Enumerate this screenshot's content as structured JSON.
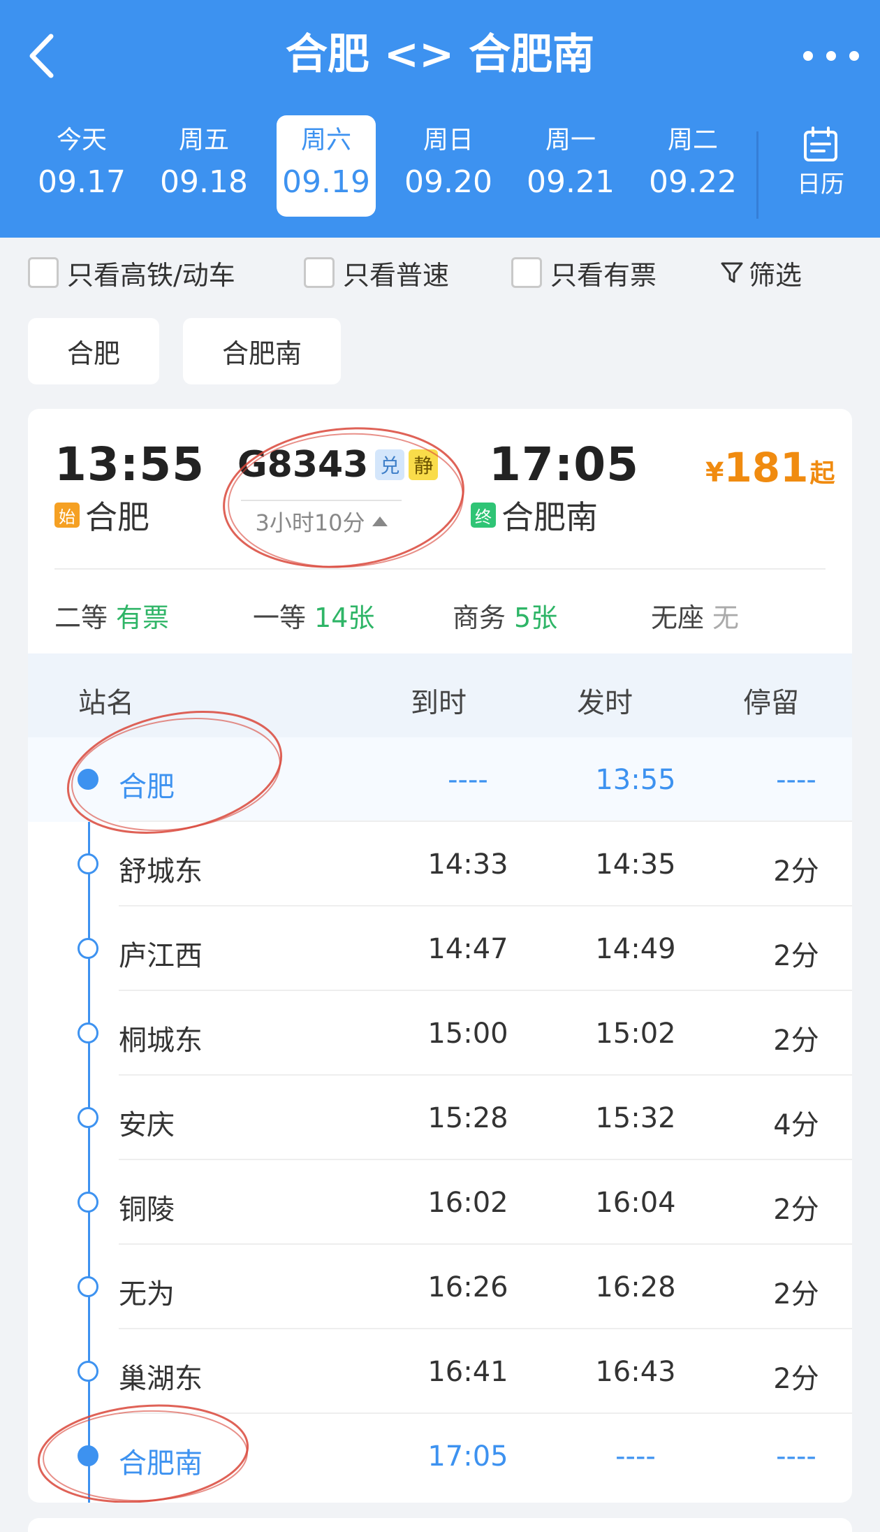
{
  "header": {
    "title": "合肥 <> 合肥南",
    "back_icon": "chevron-left-icon",
    "more_icon": "more-dots-icon"
  },
  "dates": [
    {
      "weekday": "今天",
      "date": "09.17",
      "active": false
    },
    {
      "weekday": "周五",
      "date": "09.18",
      "active": false
    },
    {
      "weekday": "周六",
      "date": "09.19",
      "active": true
    },
    {
      "weekday": "周日",
      "date": "09.20",
      "active": false
    },
    {
      "weekday": "周一",
      "date": "09.21",
      "active": false
    },
    {
      "weekday": "周二",
      "date": "09.22",
      "active": false
    }
  ],
  "calendar": {
    "label": "日历",
    "icon": "calendar-icon"
  },
  "filters": {
    "high_speed": "只看高铁/动车",
    "normal": "只看普速",
    "available": "只看有票",
    "filter": "筛选",
    "filter_icon": "funnel-icon"
  },
  "station_chips": [
    "合肥",
    "合肥南"
  ],
  "train": {
    "dep_time": "13:55",
    "dep_station": "合肥",
    "start_badge": "始",
    "train_no": "G8343",
    "tag_exchange": "兑",
    "tag_quiet": "静",
    "duration": "3小时10分",
    "arr_time": "17:05",
    "arr_station": "合肥南",
    "end_badge": "终",
    "price_currency": "¥",
    "price": "181",
    "price_suffix": "起"
  },
  "seats": [
    {
      "name": "二等",
      "value": "有票"
    },
    {
      "name": "一等",
      "value": "14张"
    },
    {
      "name": "商务",
      "value": "5张"
    },
    {
      "name": "无座",
      "value": "无"
    }
  ],
  "table": {
    "headers": {
      "station": "站名",
      "arrive": "到时",
      "depart": "发时",
      "stop": "停留"
    },
    "rows": [
      {
        "station": "合肥",
        "arrive": "----",
        "depart": "13:55",
        "stop": "----"
      },
      {
        "station": "舒城东",
        "arrive": "14:33",
        "depart": "14:35",
        "stop": "2分"
      },
      {
        "station": "庐江西",
        "arrive": "14:47",
        "depart": "14:49",
        "stop": "2分"
      },
      {
        "station": "桐城东",
        "arrive": "15:00",
        "depart": "15:02",
        "stop": "2分"
      },
      {
        "station": "安庆",
        "arrive": "15:28",
        "depart": "15:32",
        "stop": "4分"
      },
      {
        "station": "铜陵",
        "arrive": "16:02",
        "depart": "16:04",
        "stop": "2分"
      },
      {
        "station": "无为",
        "arrive": "16:26",
        "depart": "16:28",
        "stop": "2分"
      },
      {
        "station": "巢湖东",
        "arrive": "16:41",
        "depart": "16:43",
        "stop": "2分"
      },
      {
        "station": "合肥南",
        "arrive": "17:05",
        "depart": "----",
        "stop": "----"
      }
    ]
  },
  "colors": {
    "primary": "#3d92f0",
    "price": "#f08b10",
    "available": "#2fb567",
    "annotation": "#d9463a"
  }
}
